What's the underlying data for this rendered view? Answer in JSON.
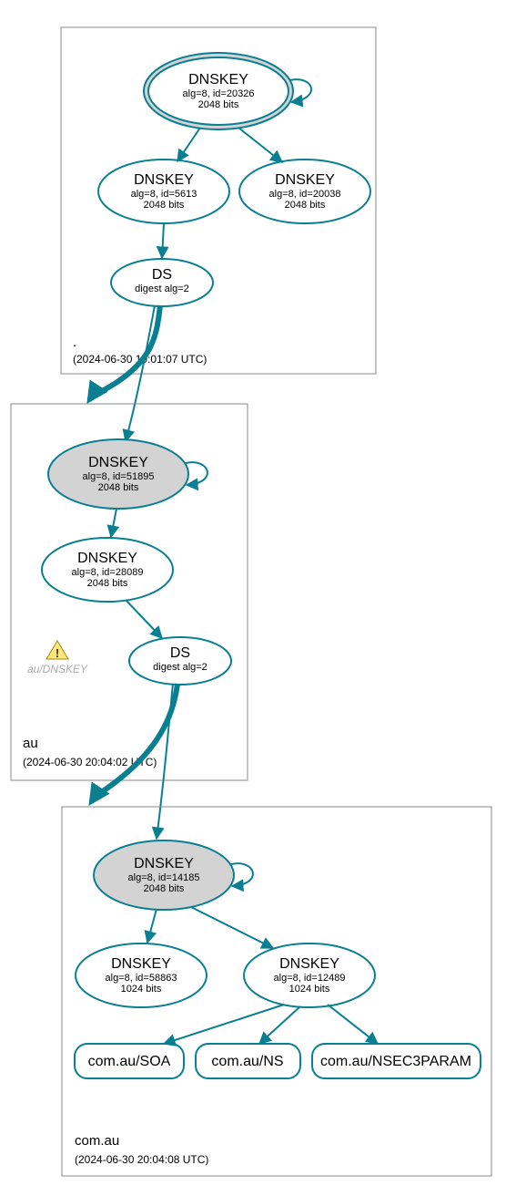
{
  "zones": {
    "root": {
      "label": ".",
      "time": "(2024-06-30 19:01:07 UTC)"
    },
    "au": {
      "label": "au",
      "time": "(2024-06-30 20:04:02 UTC)"
    },
    "comau": {
      "label": "com.au",
      "time": "(2024-06-30 20:04:08 UTC)"
    }
  },
  "nodes": {
    "root_ksk": {
      "title": "DNSKEY",
      "line2": "alg=8, id=20326",
      "line3": "2048 bits"
    },
    "root_zsk1": {
      "title": "DNSKEY",
      "line2": "alg=8, id=5613",
      "line3": "2048 bits"
    },
    "root_zsk2": {
      "title": "DNSKEY",
      "line2": "alg=8, id=20038",
      "line3": "2048 bits"
    },
    "root_ds": {
      "title": "DS",
      "line2": "digest alg=2"
    },
    "au_ksk": {
      "title": "DNSKEY",
      "line2": "alg=8, id=51895",
      "line3": "2048 bits"
    },
    "au_zsk": {
      "title": "DNSKEY",
      "line2": "alg=8, id=28089",
      "line3": "2048 bits"
    },
    "au_ds": {
      "title": "DS",
      "line2": "digest alg=2"
    },
    "comau_ksk": {
      "title": "DNSKEY",
      "line2": "alg=8, id=14185",
      "line3": "2048 bits"
    },
    "comau_zsk1": {
      "title": "DNSKEY",
      "line2": "alg=8, id=58863",
      "line3": "1024 bits"
    },
    "comau_zsk2": {
      "title": "DNSKEY",
      "line2": "alg=8, id=12489",
      "line3": "1024 bits"
    },
    "soa": {
      "title": "com.au/SOA"
    },
    "ns": {
      "title": "com.au/NS"
    },
    "nsec3": {
      "title": "com.au/NSEC3PARAM"
    }
  },
  "warn": {
    "label": "au/DNSKEY"
  }
}
